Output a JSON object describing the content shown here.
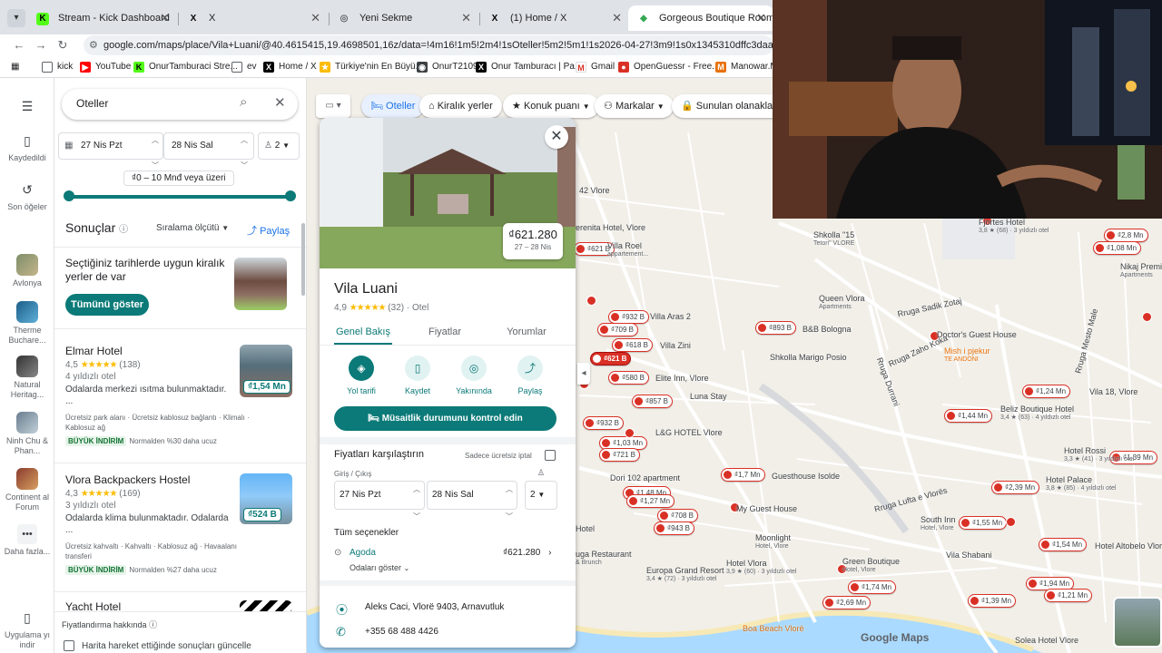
{
  "browser": {
    "tabs": [
      {
        "title": "Stream - Kick Dashboard",
        "icon": "K",
        "active": false
      },
      {
        "title": "X",
        "icon": "X",
        "active": false
      },
      {
        "title": "Yeni Sekme",
        "icon": "◎",
        "active": false
      },
      {
        "title": "(1) Home / X",
        "icon": "X",
        "active": false
      },
      {
        "title": "Gorgeous Boutique Room and",
        "icon": "◆",
        "active": true
      }
    ],
    "url": "google.com/maps/place/Vila+Luani/@40.4615415,19.4698501,16z/data=!4m16!1m5!2m4!1sOteller!5m2!5m1!1s2026-04-27!3m9!1s0x1345310dffc3daad:0x40c5eb80c170814",
    "bookmarks": [
      "kick",
      "YouTube",
      "OnurTamburaci Stre...",
      "ev",
      "Home / X",
      "Türkiye'nin En Büyü...",
      "OnurT2109",
      "Onur Tamburacı | Pa...",
      "Gmail",
      "OpenGuessr - Free...",
      "Manowar.Ma"
    ]
  },
  "rail": [
    {
      "label": "Kaydedildi",
      "icon": "bookmark-icon",
      "glyph": "▯"
    },
    {
      "label": "Son öğeler",
      "icon": "history-icon",
      "glyph": "↺"
    },
    {
      "label": "Avlonya"
    },
    {
      "label": "Therme Buchare..."
    },
    {
      "label": "Natural Heritag..."
    },
    {
      "label": "Ninh Chu & Phan..."
    },
    {
      "label": "Continent al Forum"
    },
    {
      "label": "Daha fazla..."
    },
    {
      "label": "Uygulama yı indir"
    }
  ],
  "panel": {
    "search": "Oteller",
    "checkin": "27 Nis Pzt",
    "checkout": "28 Nis Sal",
    "guests": "2",
    "price_range": "₫0 – 10 Mnđ veya üzeri",
    "results_title": "Sonuçlar",
    "sort_label": "Sıralama ölçütü",
    "share_label": "Paylaş",
    "promo_text": "Seçtiğiniz tarihlerde uygun kiralık yerler de var",
    "promo_button": "Tümünü göster",
    "hotels": [
      {
        "name": "Elmar Hotel",
        "rating": "4,5",
        "stars": "★★★★★",
        "reviews": "(138)",
        "class": "4 yıldızlı otel",
        "desc": "Odalarda merkezi ısıtma bulunmaktadır.",
        "more": "...",
        "amenities": "Ücretsiz park alanı · Ücretsiz kablosuz bağlantı · Klimalı · Kablosuz ağ",
        "deal_badge": "BÜYÜK İNDİRİM",
        "deal_text": "Normalden %30 daha ucuz",
        "price": "₫1,54 Mn"
      },
      {
        "name": "Vlora Backpackers Hostel",
        "rating": "4,3",
        "stars": "★★★★★",
        "reviews": "(169)",
        "class": "3 yıldızlı otel",
        "desc": "Odalarda klima bulunmaktadır. Odalarda",
        "more": "...",
        "amenities": "Ücretsiz kahvaltı · Kahvaltı · Kablosuz ağ · Havaalanı transferi",
        "deal_badge": "BÜYÜK İNDİRİM",
        "deal_text": "Normalden %27 daha ucuz",
        "price": "₫524 B"
      },
      {
        "name": "Yacht Hotel"
      }
    ],
    "footer": "Fiyatlandırma hakkında",
    "map_update": "Harita hareket ettiğinde sonuçları güncelle"
  },
  "map": {
    "chips": [
      "Oteller",
      "Kiralık yerler",
      "Konuk puanı",
      "Markalar",
      "Sunulan olanaklar"
    ],
    "pins": [
      {
        "label": "₫932 B"
      },
      {
        "label": "₫709 B"
      },
      {
        "label": "₫618 B"
      },
      {
        "label": "₫621 B",
        "selected": true
      },
      {
        "label": "₫580 B"
      },
      {
        "label": "₫857 B"
      },
      {
        "label": "₫932 B"
      },
      {
        "label": "₫1,03 Mn"
      },
      {
        "label": "₫721 B"
      },
      {
        "label": "₫1,48 Mn"
      },
      {
        "label": "₫1,27 Mn"
      },
      {
        "label": "₫708 B"
      },
      {
        "label": "₫943 B"
      },
      {
        "label": "₫1,7 Mn"
      },
      {
        "label": "₫893 B"
      },
      {
        "label": "₫1,24 Mn"
      },
      {
        "label": "₫1,44 Mn"
      },
      {
        "label": "₫2,39 Mn"
      },
      {
        "label": "₫1,55 Mn"
      },
      {
        "label": "₫1,54 Mn"
      },
      {
        "label": "₫1,74 Mn"
      },
      {
        "label": "₫2,69 Mn"
      },
      {
        "label": "₫1,94 Mn"
      },
      {
        "label": "₫1,39 Mn"
      },
      {
        "label": "₫1,21 Mn"
      },
      {
        "label": "₫1,39 Mn"
      },
      {
        "label": "₫2,8 Mn"
      },
      {
        "label": "₫1,08 Mn"
      },
      {
        "label": "₫621 B"
      }
    ],
    "labels": [
      {
        "text": "42 Vlore"
      },
      {
        "text": "erenita Hotel, Vlore"
      },
      {
        "text": "Villa Roel",
        "sub": "appartement..."
      },
      {
        "text": "Villa Aras 2"
      },
      {
        "text": "Villa Zini"
      },
      {
        "text": "Elite Inn, Vlore"
      },
      {
        "text": "Luna Stay"
      },
      {
        "text": "L&G HOTEL Vlore"
      },
      {
        "text": "Dori 102 apartment"
      },
      {
        "text": "My Guest House"
      },
      {
        "text": "Guesthouse Isolde"
      },
      {
        "text": "Moonlight",
        "sub": "Hotel, Vlore"
      },
      {
        "text": "Europa Grand Resort",
        "sub": "3,4 ★ (72) · 3 yıldızlı otel"
      },
      {
        "text": "Hotel Vlora",
        "sub": "3,9 ★ (60) · 3 yıldızlı otel"
      },
      {
        "text": "Green Boutique",
        "sub": "Hotel, Vlore"
      },
      {
        "text": "Boa Beach Vlorë"
      },
      {
        "text": "Queen Vlora",
        "sub": "Apartments"
      },
      {
        "text": "B&B Bologna"
      },
      {
        "text": "Doctor's Guest House"
      },
      {
        "text": "Shkolla \"15",
        "sub": "Tetori\" VLORE"
      },
      {
        "text": "Fjortes Hotel",
        "sub": "3,8 ★ (68) · 3 yıldızlı otel"
      },
      {
        "text": "Beliz Boutique Hotel",
        "sub": "3,4 ★ (63) · 4 yıldızlı otel"
      },
      {
        "text": "Vila 18, Vlore"
      },
      {
        "text": "Hotel Rossi",
        "sub": "3,3 ★ (41) · 3 yıldızlı otel"
      },
      {
        "text": "Hotel Palace",
        "sub": "3,8 ★ (85) · 4 yıldızlı otel"
      },
      {
        "text": "South Inn",
        "sub": "Hotel, Vlore"
      },
      {
        "text": "Vila Shabani"
      },
      {
        "text": "Hotel Altobelo Vlore"
      },
      {
        "text": "Solea Hotel Vlore"
      },
      {
        "text": "Nikaj Premium",
        "sub": "Apartments"
      },
      {
        "text": "Mish i pjekur",
        "sub": "TE ANDONI"
      },
      {
        "text": "Shkolla Marigo Posio"
      },
      {
        "text": "Rruga Sadik Zotaj"
      },
      {
        "text": "Rruga Zaho Koka"
      },
      {
        "text": "Rruga Durrani"
      },
      {
        "text": "Rruga Lufta e Vlorës"
      },
      {
        "text": "Rruga Mesto Male"
      },
      {
        "text": "Hotel"
      },
      {
        "text": "uga Restaurant",
        "sub": "& Brunch"
      }
    ],
    "attribution": "Google Maps"
  },
  "card": {
    "title": "Vila Luani",
    "rating": "4,9",
    "stars": "★★★★★",
    "reviews": "(32)",
    "type": "Otel",
    "photo_price": "₫621.280",
    "photo_dates": "27 – 28 Nis",
    "tabs": [
      "Genel Bakış",
      "Fiyatlar",
      "Yorumlar"
    ],
    "actions": [
      "Yol tarifi",
      "Kaydet",
      "Yakınında",
      "Paylaş"
    ],
    "cta": "Müsaitlik durumunu kontrol edin",
    "compare_title": "Fiyatları karşılaştırın",
    "free_cancel": "Sadece ücretsiz iptal",
    "checkin_label": "Giriş / Çıkış",
    "checkin": "27 Nis Pzt",
    "checkout": "28 Nis Sal",
    "guests": "2",
    "all_options": "Tüm seçenekler",
    "provider": "Agoda",
    "provider_price": "₫621.280",
    "rooms_link": "Odaları göster",
    "address": "Aleks Caci, Vlorë 9403, Arnavutluk",
    "phone": "+355 68 488 4426"
  },
  "colors": {
    "accent": "#0b7a78",
    "pin": "#d93025",
    "link": "#1a73e8"
  }
}
